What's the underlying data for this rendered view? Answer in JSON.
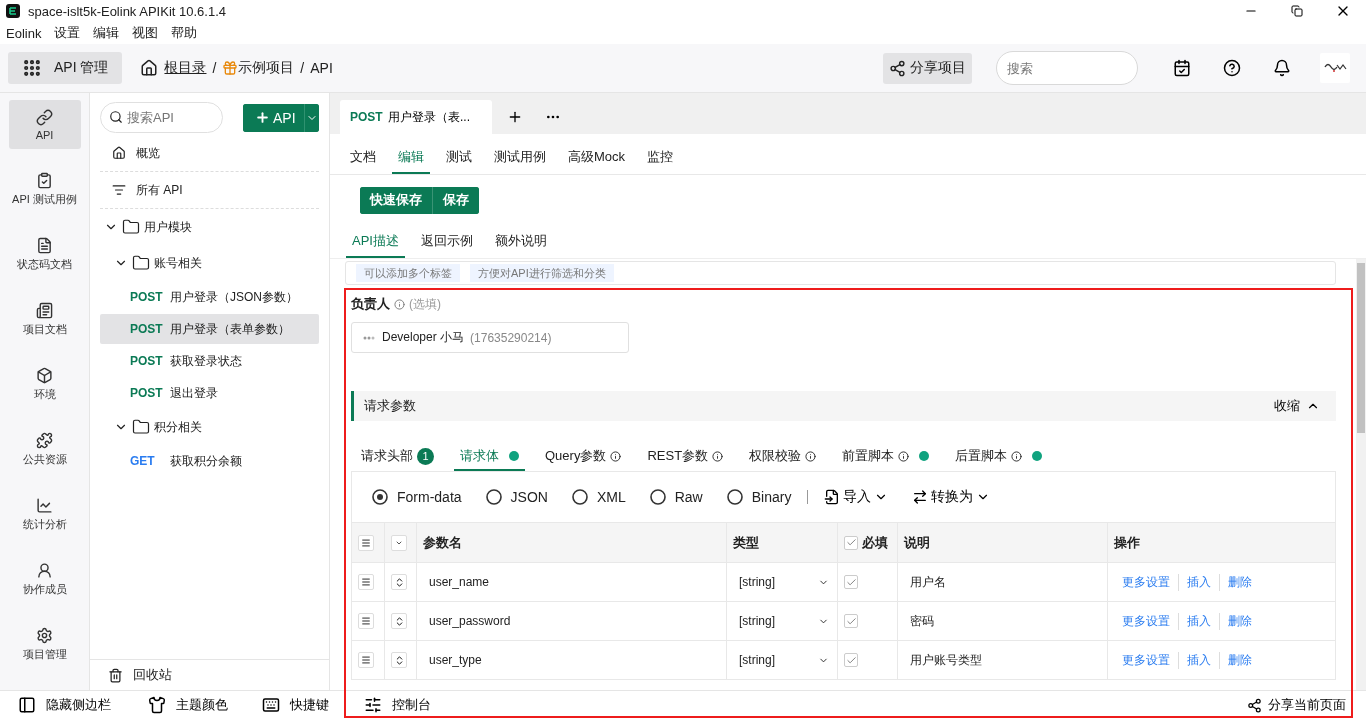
{
  "window": {
    "title": "space-islt5k-Eolink APIKit 10.6.1.4",
    "menu": [
      "Eolink",
      "设置",
      "编辑",
      "视图",
      "帮助"
    ]
  },
  "toolbar": {
    "module": "API 管理",
    "breadcrumb": [
      {
        "label": "根目录",
        "kind": "home"
      },
      {
        "separator": "/",
        "label": "示例项目",
        "kind": "project"
      },
      {
        "separator": "/",
        "label": "API",
        "kind": "plain"
      }
    ],
    "share": "分享项目",
    "search_placeholder": "搜索"
  },
  "rail": [
    {
      "label": "API",
      "selected": true
    },
    {
      "label": "API 测试用例",
      "selected": false
    },
    {
      "label": "状态码文档",
      "selected": false
    },
    {
      "label": "项目文档",
      "selected": false
    },
    {
      "label": "环境",
      "selected": false
    },
    {
      "label": "公共资源",
      "selected": false
    },
    {
      "label": "统计分析",
      "selected": false
    },
    {
      "label": "协作成员",
      "selected": false
    },
    {
      "label": "项目管理",
      "selected": false
    }
  ],
  "tree": {
    "search_placeholder": "搜索API",
    "add_button": "API",
    "nav": [
      "概览",
      "所有 API"
    ],
    "folders": [
      {
        "kind": "folder",
        "label": "用户模块",
        "expanded": true,
        "children": [
          {
            "kind": "folder",
            "label": "账号相关",
            "expanded": true,
            "children": [
              {
                "kind": "api",
                "method": "POST",
                "name": "用户登录（JSON参数）",
                "selected": false
              },
              {
                "kind": "api",
                "method": "POST",
                "name": "用户登录（表单参数）",
                "selected": true
              },
              {
                "kind": "api",
                "method": "POST",
                "name": "获取登录状态",
                "selected": false
              },
              {
                "kind": "api",
                "method": "POST",
                "name": "退出登录",
                "selected": false
              }
            ]
          },
          {
            "kind": "folder",
            "label": "积分相关",
            "expanded": true,
            "children": [
              {
                "kind": "api",
                "method": "GET",
                "name": "获取积分余额",
                "selected": false
              }
            ]
          }
        ]
      }
    ],
    "recycle": "回收站"
  },
  "editor": {
    "open_tab": {
      "method": "POST",
      "name": "用户登录（表..."
    },
    "top_tabs": [
      {
        "label": "文档",
        "selected": false
      },
      {
        "label": "编辑",
        "selected": true
      },
      {
        "label": "测试",
        "selected": false
      },
      {
        "label": "测试用例",
        "selected": false
      },
      {
        "label": "高级Mock",
        "selected": false
      },
      {
        "label": "监控",
        "selected": false
      }
    ],
    "save_buttons": [
      "快速保存",
      "保存"
    ],
    "sub_tabs": [
      {
        "label": "API描述",
        "selected": true
      },
      {
        "label": "返回示例",
        "selected": false
      },
      {
        "label": "额外说明",
        "selected": false
      }
    ],
    "tags": [
      "可以添加多个标签",
      "方便对API进行筛选和分类"
    ],
    "owner": {
      "label": "负责人",
      "hint": "(选填)",
      "name": "Developer 小马",
      "phone": "(17635290214)"
    },
    "section": {
      "title": "请求参数",
      "toggle": "收缩"
    },
    "param_tabs": [
      {
        "label": "请求头部",
        "badge": "1",
        "selected": false
      },
      {
        "label": "请求体",
        "dot": true,
        "selected": true
      },
      {
        "label": "Query参数",
        "info": true,
        "selected": false
      },
      {
        "label": "REST参数",
        "info": true,
        "selected": false
      },
      {
        "label": "权限校验",
        "info": true,
        "selected": false
      },
      {
        "label": "前置脚本",
        "dot": true,
        "info": true,
        "selected": false
      },
      {
        "label": "后置脚本",
        "dot": true,
        "info": true,
        "selected": false
      }
    ],
    "body_types": [
      {
        "label": "Form-data",
        "selected": true
      },
      {
        "label": "JSON",
        "selected": false
      },
      {
        "label": "XML",
        "selected": false
      },
      {
        "label": "Raw",
        "selected": false
      },
      {
        "label": "Binary",
        "selected": false
      }
    ],
    "tools": [
      "导入",
      "转换为"
    ],
    "columns": {
      "name": "参数名",
      "type": "类型",
      "required": "必填",
      "required_all": true,
      "desc": "说明",
      "actions": "操作"
    },
    "rows": [
      {
        "name": "user_name",
        "type": "[string]",
        "required": true,
        "desc": "用户名",
        "actions": [
          "更多设置",
          "插入",
          "删除"
        ]
      },
      {
        "name": "user_password",
        "type": "[string]",
        "required": true,
        "desc": "密码",
        "actions": [
          "更多设置",
          "插入",
          "删除"
        ]
      },
      {
        "name": "user_type",
        "type": "[string]",
        "required": true,
        "desc": "用户账号类型",
        "actions": [
          "更多设置",
          "插入",
          "删除"
        ]
      }
    ]
  },
  "bottom_bar": {
    "items": [
      "隐藏侧边栏",
      "主题颜色",
      "快捷键",
      "控制台"
    ],
    "right": "分享当前页面"
  }
}
